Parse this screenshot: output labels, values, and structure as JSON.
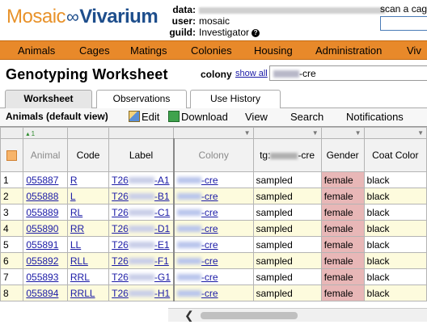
{
  "header": {
    "logo_left": "Mosaic",
    "logo_infinity": "∞",
    "logo_right": "Vivarium",
    "data_label": "data:",
    "user_label": "user:",
    "user_value": "mosaic",
    "guild_label": "guild:",
    "guild_value": "Investigator",
    "help_icon": "?",
    "scan_label": "scan a cag"
  },
  "nav": {
    "items": [
      "Animals",
      "Cages",
      "Matings",
      "Colonies",
      "Housing",
      "Administration",
      "Viv"
    ]
  },
  "page": {
    "title": "Genotyping Worksheet",
    "colony_label": "colony",
    "show_all": "show all",
    "colony_value_suffix": "-cre"
  },
  "tabs": [
    "Worksheet",
    "Observations",
    "Use History"
  ],
  "toolbar": {
    "view_title": "Animals (default view)",
    "edit": "Edit",
    "download": "Download",
    "view": "View",
    "search": "Search",
    "notifications": "Notifications"
  },
  "grid": {
    "sort_indicator": "▴ 1",
    "columns": {
      "animal": "Animal",
      "code": "Code",
      "label": "Label",
      "colony": "Colony",
      "tg_prefix": "tg:",
      "tg_suffix": "-cre",
      "gender": "Gender",
      "coat_color": "Coat Color"
    },
    "rows": [
      {
        "n": "1",
        "animal": "055887",
        "code": "R",
        "label_prefix": "T26",
        "label_suffix": "-A1",
        "colony_suffix": "-cre",
        "tg": "sampled",
        "gender": "female",
        "coat": "black"
      },
      {
        "n": "2",
        "animal": "055888",
        "code": "L",
        "label_prefix": "T26",
        "label_suffix": "-B1",
        "colony_suffix": "-cre",
        "tg": "sampled",
        "gender": "female",
        "coat": "black"
      },
      {
        "n": "3",
        "animal": "055889",
        "code": "RL",
        "label_prefix": "T26",
        "label_suffix": "-C1",
        "colony_suffix": "-cre",
        "tg": "sampled",
        "gender": "female",
        "coat": "black"
      },
      {
        "n": "4",
        "animal": "055890",
        "code": "RR",
        "label_prefix": "T26",
        "label_suffix": "-D1",
        "colony_suffix": "-cre",
        "tg": "sampled",
        "gender": "female",
        "coat": "black"
      },
      {
        "n": "5",
        "animal": "055891",
        "code": "LL",
        "label_prefix": "T26",
        "label_suffix": "-E1",
        "colony_suffix": "-cre",
        "tg": "sampled",
        "gender": "female",
        "coat": "black"
      },
      {
        "n": "6",
        "animal": "055892",
        "code": "RLL",
        "label_prefix": "T26",
        "label_suffix": "-F1",
        "colony_suffix": "-cre",
        "tg": "sampled",
        "gender": "female",
        "coat": "black"
      },
      {
        "n": "7",
        "animal": "055893",
        "code": "RRL",
        "label_prefix": "T26",
        "label_suffix": "-G1",
        "colony_suffix": "-cre",
        "tg": "sampled",
        "gender": "female",
        "coat": "black"
      },
      {
        "n": "8",
        "animal": "055894",
        "code": "RRLL",
        "label_prefix": "T26",
        "label_suffix": "-H1",
        "colony_suffix": "-cre",
        "tg": "sampled",
        "gender": "female",
        "coat": "black"
      }
    ]
  },
  "scrollbar": {
    "left_arrow": "❮"
  },
  "colors": {
    "nav_bg": "#e8892a",
    "logo_orange": "#e8922a",
    "logo_blue": "#1e4e8c",
    "link": "#1a1aa6",
    "row_alt": "#fdfbdd",
    "gender_bg": "#e8b7b7"
  }
}
